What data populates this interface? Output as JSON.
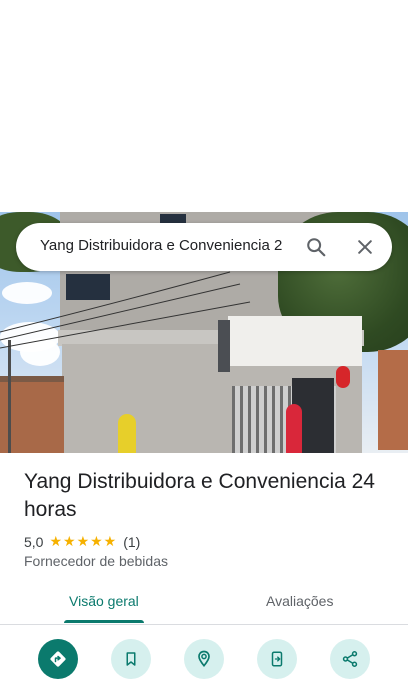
{
  "search": {
    "query": "Yang Distribuidora e Conveniencia 2"
  },
  "place": {
    "name": "Yang Distribuidora e Conveniencia 24 horas",
    "rating": "5,0",
    "stars": "★★★★★",
    "review_count": "(1)",
    "category": "Fornecedor de bebidas"
  },
  "tabs": [
    {
      "label": "Visão geral",
      "selected": true
    },
    {
      "label": "Avaliações",
      "selected": false
    }
  ],
  "actions": [
    {
      "icon": "directions-icon"
    },
    {
      "icon": "bookmark-icon"
    },
    {
      "icon": "nearby-icon"
    },
    {
      "icon": "send-to-phone-icon"
    },
    {
      "icon": "share-icon"
    }
  ],
  "colors": {
    "accent": "#0b7a6d",
    "accent_light": "#d6f0ee",
    "star": "#f6b100",
    "text_primary": "#202124",
    "text_secondary": "#5f6368"
  }
}
